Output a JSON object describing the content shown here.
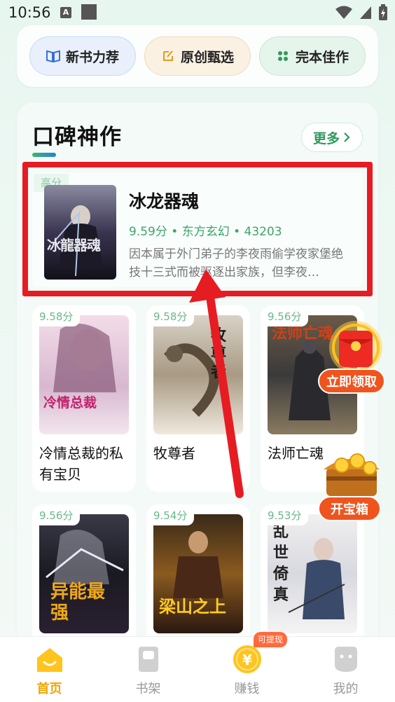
{
  "status_bar": {
    "time": "10:56",
    "a_icon": "A"
  },
  "categories": [
    {
      "label": "新书力荐",
      "icon": "book-open-icon",
      "color": "#3b6fd6"
    },
    {
      "label": "原创甄选",
      "icon": "pen-icon",
      "color": "#e39a1e"
    },
    {
      "label": "完本佳作",
      "icon": "grid-icon",
      "color": "#2e9a5a"
    }
  ],
  "section": {
    "title": "口碑神作",
    "more_label": "更多"
  },
  "featured": {
    "badge": "高分",
    "title": "冰龙器魂",
    "score": "9.59分",
    "genre": "东方玄幻",
    "count": "43203",
    "description": "因本属于外门弟子的李夜雨偷学夜家堡绝技十三式而被驱逐出家族，但李夜…",
    "cover_text": "冰龍器魂"
  },
  "books": [
    {
      "score": "9.58分",
      "name": "冷情总裁的私有宝贝",
      "cover_text": "冷情总裁"
    },
    {
      "score": "9.58分",
      "name": "牧尊者",
      "cover_text": "牧尊者"
    },
    {
      "score": "9.56分",
      "name": "法师亡魂",
      "cover_text": "法师亡魂"
    },
    {
      "score": "9.56分",
      "name": "",
      "cover_text": "异能最强"
    },
    {
      "score": "9.54分",
      "name": "",
      "cover_text": "梁山之上"
    },
    {
      "score": "9.53分",
      "name": "",
      "cover_text": "乱世倚真"
    }
  ],
  "floating": {
    "red_packet_label": "立即领取",
    "chest_label": "开宝箱"
  },
  "bottom_nav": {
    "withdraw_badge": "可提现",
    "items": [
      {
        "label": "首页",
        "icon": "home-icon",
        "active": true
      },
      {
        "label": "书架",
        "icon": "bookshelf-icon",
        "active": false
      },
      {
        "label": "赚钱",
        "icon": "coin-icon",
        "active": false
      },
      {
        "label": "我的",
        "icon": "profile-icon",
        "active": false
      }
    ]
  },
  "colors": {
    "accent_green": "#2e9a5a",
    "highlight_red": "#e61c23",
    "nav_active": "#f0a500"
  }
}
